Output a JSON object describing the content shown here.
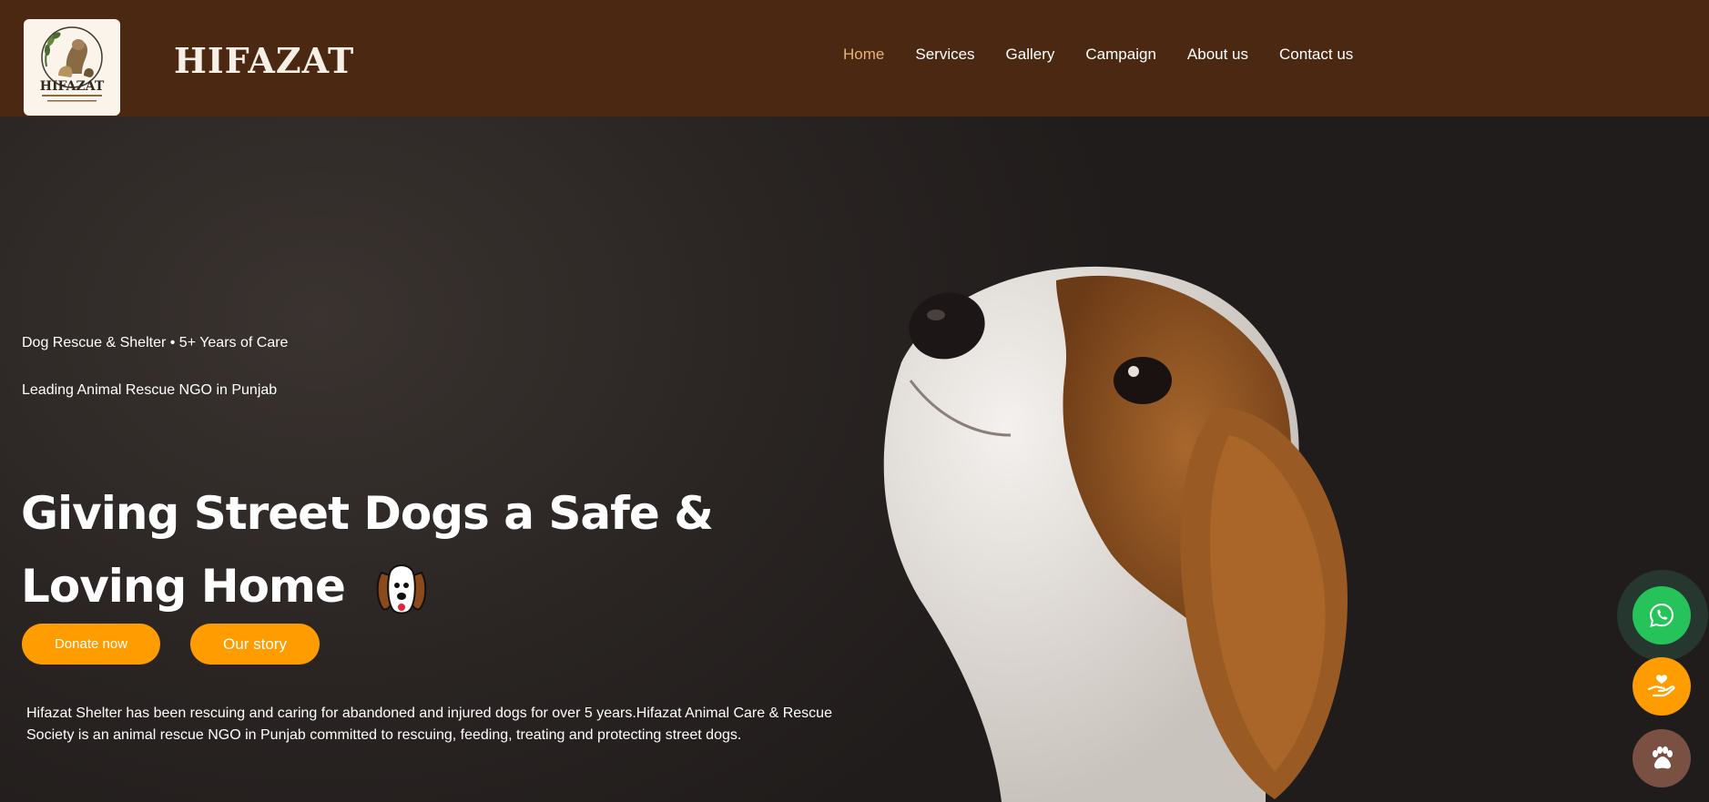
{
  "header": {
    "logo_text": "HIFAZAT",
    "brand": "HIFAZAT",
    "nav": [
      {
        "label": "Home",
        "active": true
      },
      {
        "label": "Services",
        "active": false
      },
      {
        "label": "Gallery",
        "active": false
      },
      {
        "label": "Campaign",
        "active": false
      },
      {
        "label": "About us",
        "active": false
      },
      {
        "label": "Contact us",
        "active": false
      }
    ]
  },
  "hero": {
    "tagline_1": "Dog Rescue & Shelter • 5+ Years of Care",
    "tagline_2": "Leading Animal Rescue NGO in Punjab",
    "headline": "Giving Street Dogs a Safe & Loving Home",
    "donate_label": "Donate now",
    "story_label": "Our story",
    "about": "Hifazat Shelter has been rescuing and caring for abandoned and injured dogs for over 5 years.Hifazat Animal Care & Rescue Society is an animal rescue NGO in Punjab committed to rescuing, feeding, treating and protecting street dogs."
  },
  "floating": {
    "whatsapp_icon": "whatsapp-icon",
    "donate_icon": "heart-hand-icon",
    "paw_icon": "paw-icon"
  },
  "colors": {
    "header_bg": "#4a2811",
    "accent": "#ff9d00",
    "nav_active": "#e8b27a",
    "whatsapp": "#25c35a",
    "paw_button": "#7a5042"
  }
}
